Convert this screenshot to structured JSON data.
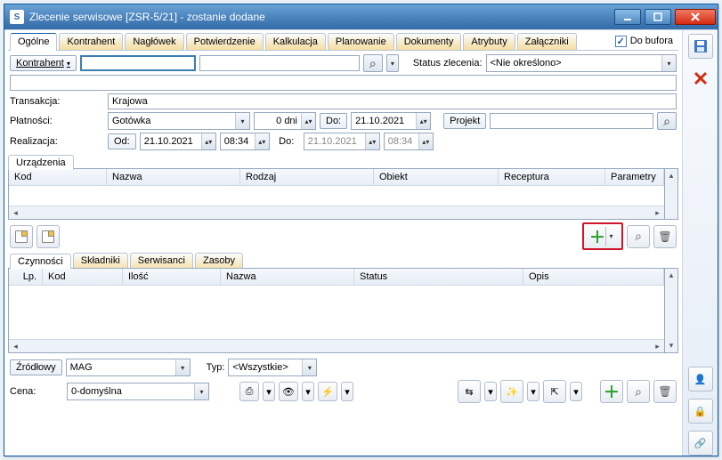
{
  "window": {
    "title": "Zlecenie serwisowe [ZSR-5/21]  - zostanie dodane",
    "icon_glyph": "S"
  },
  "tabs": [
    {
      "label": "Ogólne",
      "active": true
    },
    {
      "label": "Kontrahent"
    },
    {
      "label": "Nagłówek"
    },
    {
      "label": "Potwierdzenie"
    },
    {
      "label": "Kalkulacja"
    },
    {
      "label": "Planowanie"
    },
    {
      "label": "Dokumenty"
    },
    {
      "label": "Atrybuty"
    },
    {
      "label": "Załączniki"
    }
  ],
  "buffer": {
    "checked": true,
    "label": "Do bufora"
  },
  "form": {
    "kontrahent_btn": "Kontrahent",
    "status_label": "Status zlecenia:",
    "status_value": "<Nie określono>",
    "transakcja_label": "Transakcja:",
    "transakcja_value": "Krajowa",
    "platnosci_label": "Płatności:",
    "platnosci_value": "Gotówka",
    "platnosci_dni": "0 dni",
    "do_btn": "Do:",
    "do_date": "21.10.2021",
    "projekt_btn": "Projekt",
    "realizacja_label": "Realizacja:",
    "od_btn": "Od:",
    "od_date": "21.10.2021",
    "od_time": "08:34",
    "real_do_label": "Do:",
    "real_do_date": "21.10.2021",
    "real_do_time": "08:34"
  },
  "devices": {
    "tab_label": "Urządzenia",
    "cols": [
      "Kod",
      "Nazwa",
      "Rodzaj",
      "Obiekt",
      "Receptura",
      "Parametry"
    ]
  },
  "subtabs": [
    {
      "label": "Czynności",
      "active": true
    },
    {
      "label": "Składniki"
    },
    {
      "label": "Serwisanci"
    },
    {
      "label": "Zasoby"
    }
  ],
  "subgrid_cols": [
    "Lp.",
    "Kod",
    "Ilość",
    "Nazwa",
    "Status",
    "Opis"
  ],
  "bottom": {
    "zrodlowy_label": "Źródłowy",
    "zrodlowy_value": "MAG",
    "typ_label": "Typ:",
    "typ_value": "<Wszystkie>",
    "cena_label": "Cena:",
    "cena_value": "0-domyślna"
  }
}
